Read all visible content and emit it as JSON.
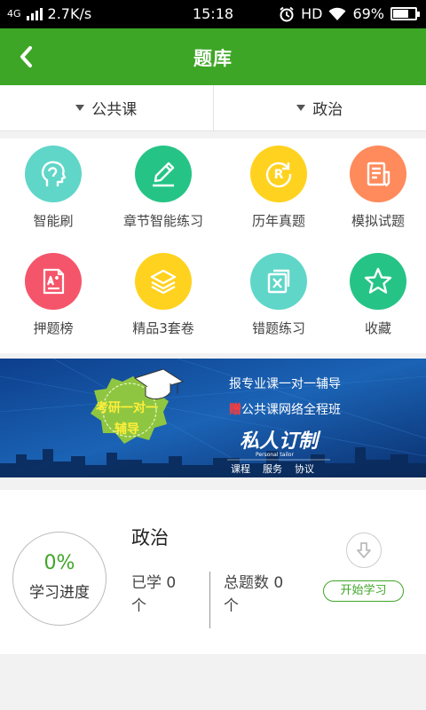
{
  "status_bar": {
    "network": "4G",
    "speed": "2.7K/s",
    "time": "15:18",
    "hd": "HD",
    "battery": "69%",
    "battery_level": 0.69
  },
  "header": {
    "title": "题库"
  },
  "filters": [
    {
      "label": "公共课"
    },
    {
      "label": "政治"
    }
  ],
  "grid": [
    {
      "label": "智能刷",
      "icon": "head-icon",
      "color": "#5fd6c8"
    },
    {
      "label": "章节智能练习",
      "icon": "pencil-icon",
      "color": "#25c486"
    },
    {
      "label": "历年真题",
      "icon": "registered-icon",
      "color": "#ffd21f"
    },
    {
      "label": "模拟试题",
      "icon": "document-edit-icon",
      "color": "#ff8a5c"
    },
    {
      "label": "押题榜",
      "icon": "exam-paper-icon",
      "color": "#f5556a"
    },
    {
      "label": "精品3套卷",
      "icon": "layers-icon",
      "color": "#ffd21f"
    },
    {
      "label": "错题练习",
      "icon": "wrong-box-icon",
      "color": "#5fd6c8"
    },
    {
      "label": "收藏",
      "icon": "star-icon",
      "color": "#25c486"
    }
  ],
  "banner": {
    "badge_line1": "考研一对一",
    "badge_line2": "辅导",
    "line1": "报专业课一对一辅导",
    "line2_prefix": "赠",
    "line2": "公共课网络全程班",
    "brand": "私人订制",
    "brand_sub": "Personal tailor",
    "tags": [
      "课程",
      "服务",
      "协议"
    ]
  },
  "course": {
    "progress": "0%",
    "progress_label": "学习进度",
    "title": "政治",
    "learned_label": "已学 0",
    "learned_unit": "个",
    "total_label": "总题数 0",
    "total_unit": "个",
    "start_button": "开始学习"
  }
}
